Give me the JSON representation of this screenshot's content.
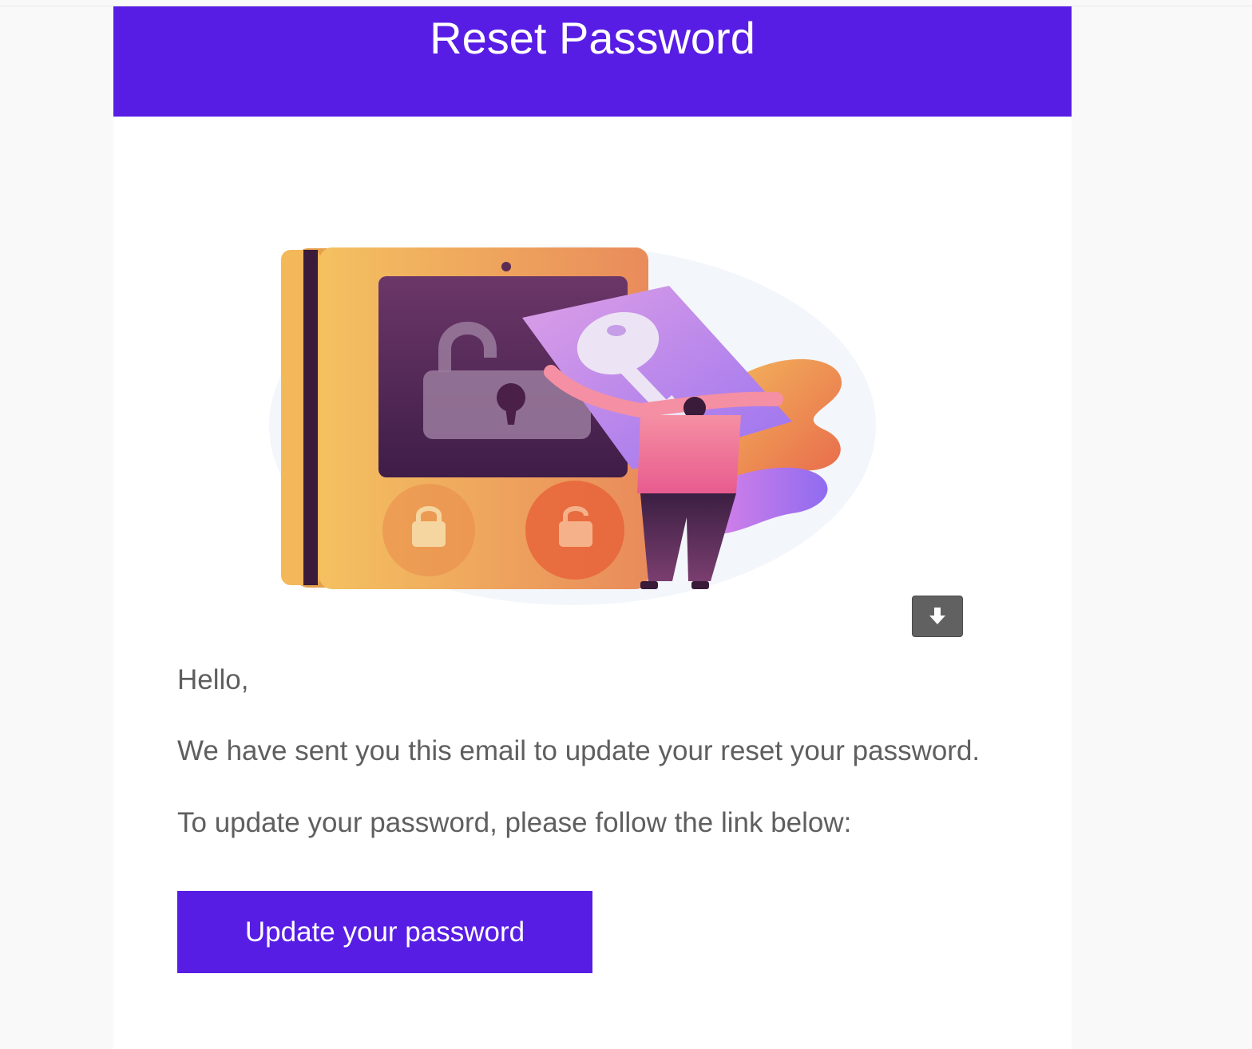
{
  "header": {
    "title": "Reset Password",
    "background_color": "#581de5"
  },
  "illustration": {
    "subject": "unlocking-phone-with-key-illustration"
  },
  "download": {
    "icon": "download-arrow-icon"
  },
  "body": {
    "greeting": "Hello,",
    "message": "We have sent you this email to update your reset your password.",
    "instruction": "To update your password, please follow the link below:"
  },
  "cta": {
    "label": "Update your password",
    "background_color": "#581de5"
  }
}
